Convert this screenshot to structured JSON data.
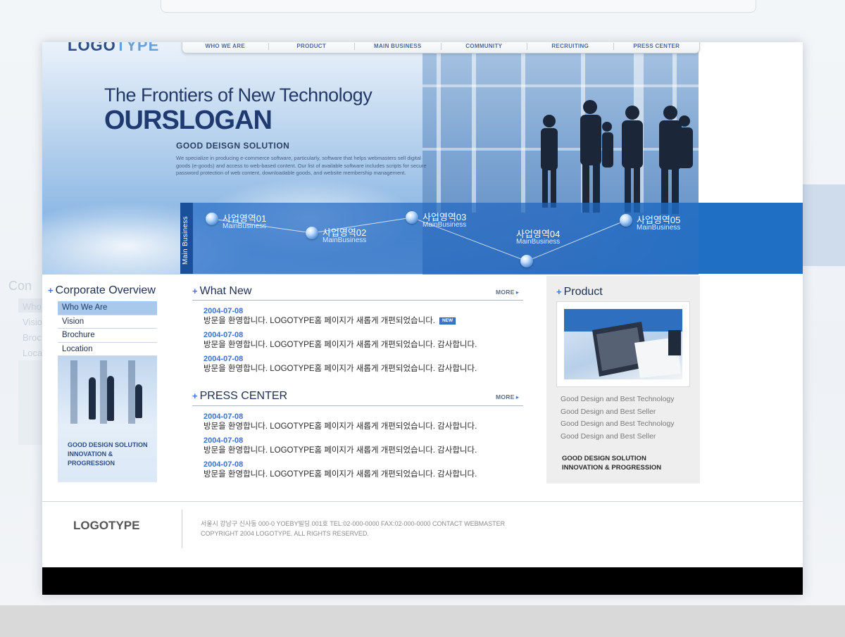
{
  "brand": {
    "logo": "LOGOTYPE",
    "logo_visible_dark": "LOGO",
    "logo_visible_light": "TYPE"
  },
  "nav": {
    "items": [
      "WHO WE ARE",
      "PRODUCT",
      "MAIN BUSINESS",
      "COMMUNITY",
      "RECRUITING",
      "PRESS CENTER"
    ]
  },
  "hero": {
    "title": "The Frontiers of New Technology",
    "slogan": "OURSLOGAN",
    "subtitle": "GOOD DEISGN SOLUTION",
    "description": "We specialize in producing e-commerce software, particularly, software that helps webmasters sell digital goods (e-goods) and access to web-based content. Our list of available software includes scripts for secure password protection of web content, downloadable goods, and website membership management."
  },
  "main_business": {
    "label": "Main Business",
    "nodes": [
      {
        "title": "사업영역01",
        "sub": "MainBusiness"
      },
      {
        "title": "사업영역02",
        "sub": "MainBusiness"
      },
      {
        "title": "사업영역03",
        "sub": "MainBusiness"
      },
      {
        "title": "사업영역04",
        "sub": "MainBusiness"
      },
      {
        "title": "사업영역05",
        "sub": "MainBusiness"
      }
    ]
  },
  "sidebar": {
    "title": "Corporate Overview",
    "items": [
      "Who We Are",
      "Vision",
      "Brochure",
      "Location"
    ],
    "active": "Who We Are",
    "caption": [
      "GOOD DESIGN SOLUTION",
      "INNOVATION &",
      "PROGRESSION"
    ]
  },
  "whats_new": {
    "title": "What New",
    "more": "MORE",
    "badge": "NEW",
    "items": [
      {
        "date": "2004-07-08",
        "text": "방문을 환영합니다. LOGOTYPE홈 페이지가 새롭게 개편되었습니다."
      },
      {
        "date": "2004-07-08",
        "text": "방문을 환영합니다. LOGOTYPE홈 페이지가 새롭게 개편되었습니다. 감사합니다."
      },
      {
        "date": "2004-07-08",
        "text": "방문을 환영합니다. LOGOTYPE홈 페이지가 새롭게 개편되었습니다. 감사합니다."
      }
    ]
  },
  "press_center": {
    "title": "PRESS CENTER",
    "more": "MORE",
    "items": [
      {
        "date": "2004-07-08",
        "text": "방문을 환영합니다. LOGOTYPE홈 페이지가 새롭게 개편되었습니다. 감사합니다."
      },
      {
        "date": "2004-07-08",
        "text": "방문을 환영합니다. LOGOTYPE홈 페이지가 새롭게 개편되었습니다. 감사합니다."
      },
      {
        "date": "2004-07-08",
        "text": "방문을 환영합니다. LOGOTYPE홈 페이지가 새롭게 개편되었습니다. 감사합니다."
      }
    ]
  },
  "product": {
    "title": "Product",
    "links": [
      "Good Design and Best Technology",
      "Good Design and Best Seller",
      "Good Design and Best Technology",
      "Good Design and Best Seller"
    ],
    "caption": [
      "GOOD DESIGN SOLUTION",
      "INNOVATION & PROGRESSION"
    ]
  },
  "footer": {
    "logo": "LOGOTYPE",
    "address": "서울시 강남구 신사동 000-0 YOEBY빌딩 001호 TEL:02-000-0000 FAX:02-000-0000 CONTACT WEBMASTER",
    "copyright": "COPYRIGHT 2004 LOGOTYPE. ALL RIGHTS RESERVED."
  },
  "ghost": {
    "left_label": "Con",
    "left_items": [
      "Who",
      "Visio",
      "Broc",
      "Loca"
    ]
  },
  "colors": {
    "accent": "#1f6fc4",
    "heading": "#1f2f4f",
    "date": "#3d72c8",
    "sidebar_active": "#a9c9ec"
  },
  "icons": [
    "plus-icon",
    "arrow-right-icon",
    "new-badge"
  ]
}
